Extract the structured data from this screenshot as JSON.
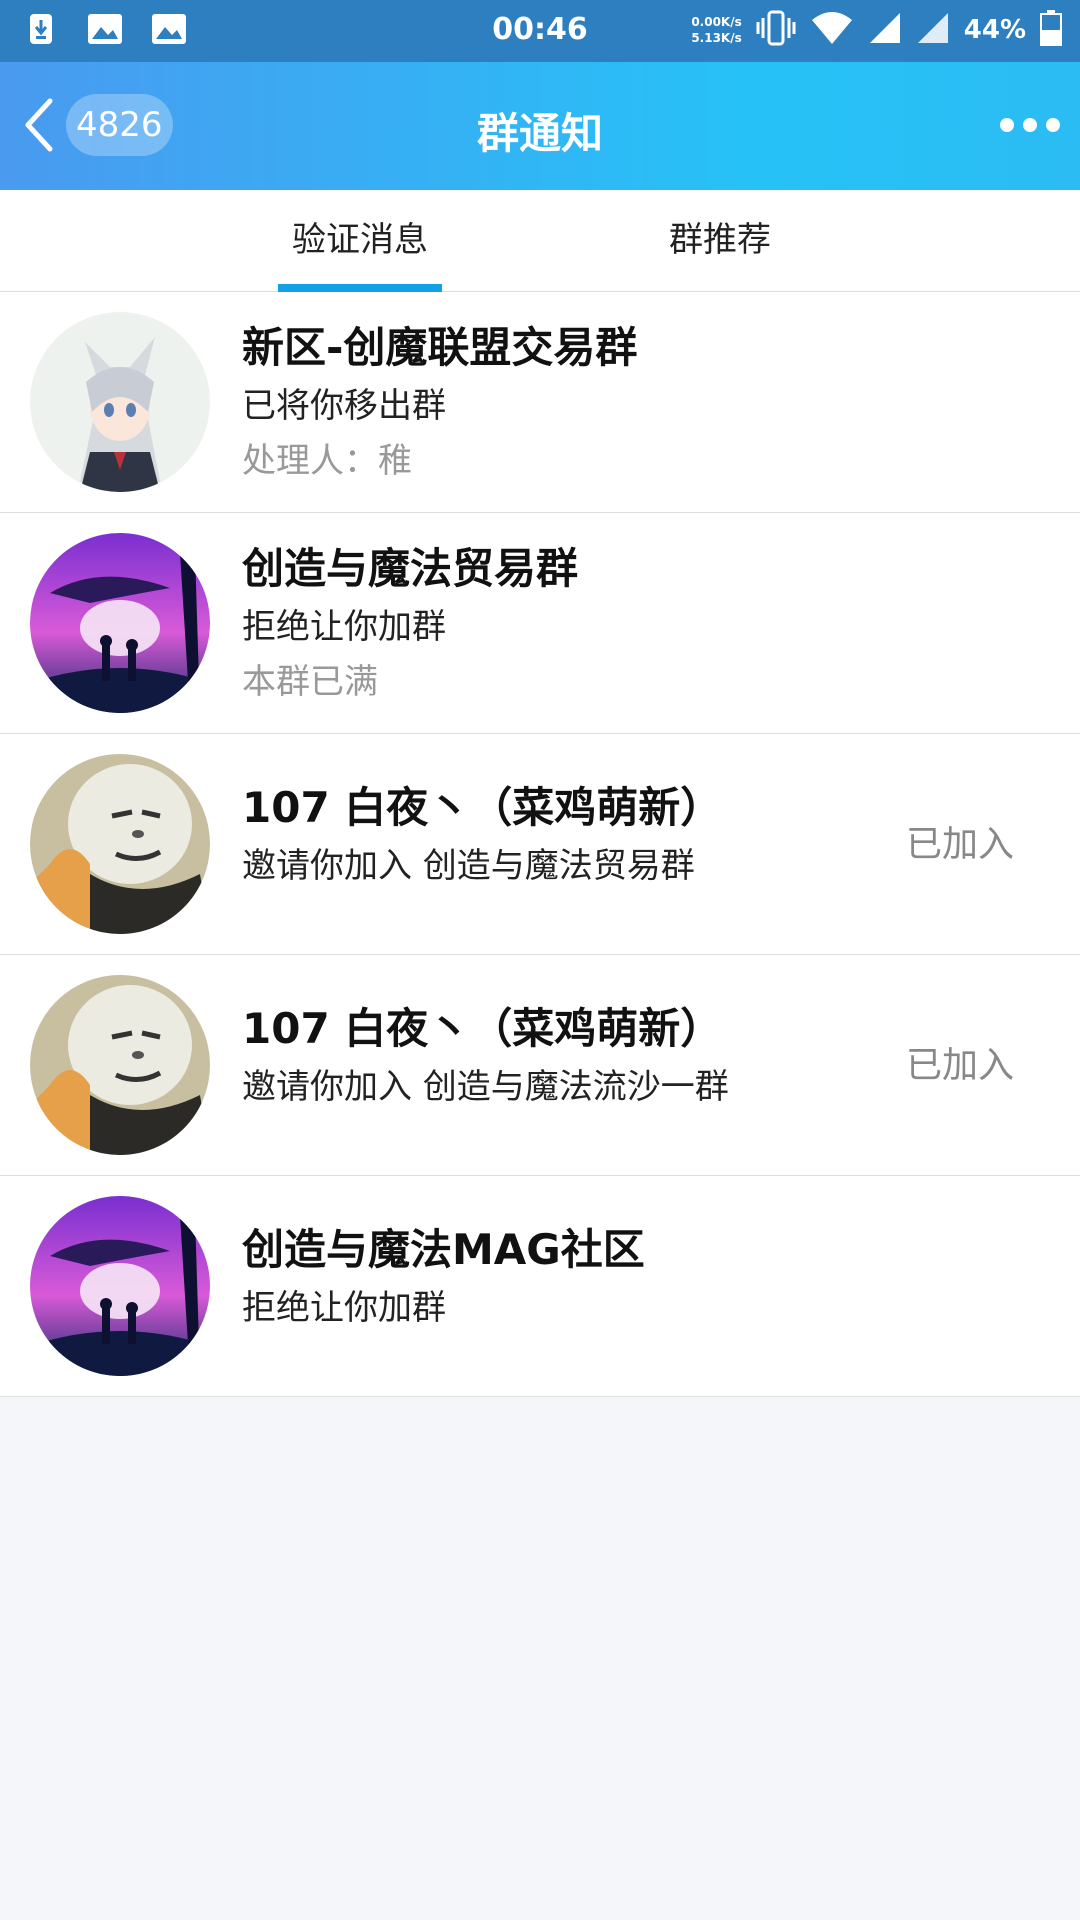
{
  "status_bar": {
    "time": "00:46",
    "speed_up": "0.00K/s",
    "speed_down": "5.13K/s",
    "battery": "44%"
  },
  "header": {
    "back_count": "4826",
    "title": "群通知"
  },
  "tabs": [
    {
      "label": "验证消息",
      "active": true
    },
    {
      "label": "群推荐",
      "active": false
    }
  ],
  "notifications": [
    {
      "name": "新区-创魔联盟交易群",
      "message": "已将你移出群",
      "note": "处理人：稚",
      "status": ""
    },
    {
      "name": "创造与魔法贸易群",
      "message": "拒绝让你加群",
      "note": "本群已满",
      "status": ""
    },
    {
      "name": "107 白夜丶（菜鸡萌新）",
      "message": "邀请你加入 创造与魔法贸易群",
      "note": "",
      "status": "已加入"
    },
    {
      "name": "107 白夜丶（菜鸡萌新）",
      "message": "邀请你加入 创造与魔法流沙一群",
      "note": "",
      "status": "已加入"
    },
    {
      "name": "创造与魔法MAG社区",
      "message": "拒绝让你加群",
      "note": "",
      "status": ""
    }
  ],
  "colors": {
    "header_start": "#4a9af0",
    "header_end": "#26c2f7",
    "tab_indicator": "#12a0e8",
    "status_bar": "#2d7fc0"
  }
}
